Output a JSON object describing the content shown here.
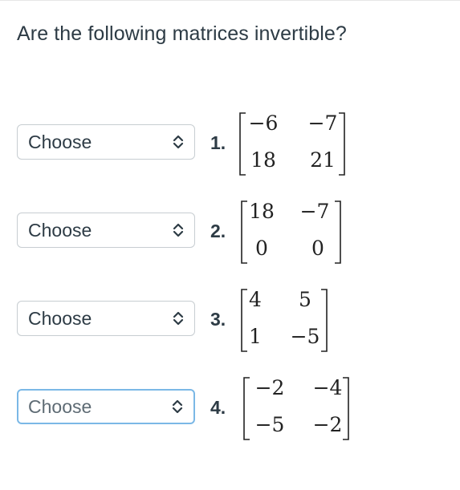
{
  "question": "Are the following matrices invertible?",
  "items": [
    {
      "number": "1.",
      "select": {
        "value": "Choose",
        "focused": false
      },
      "matrix": [
        [
          "−6",
          "−7"
        ],
        [
          "18",
          "21"
        ]
      ]
    },
    {
      "number": "2.",
      "select": {
        "value": "Choose",
        "focused": false
      },
      "matrix": [
        [
          "18",
          "−7"
        ],
        [
          "0",
          "0"
        ]
      ]
    },
    {
      "number": "3.",
      "select": {
        "value": "Choose",
        "focused": false
      },
      "matrix": [
        [
          "4",
          "5"
        ],
        [
          "1",
          "−5"
        ]
      ]
    },
    {
      "number": "4.",
      "select": {
        "value": "Choose",
        "focused": true
      },
      "matrix": [
        [
          "−2",
          "−4"
        ],
        [
          "−5",
          "−2"
        ]
      ]
    }
  ],
  "icons": {
    "select_arrows": "chevron-up-down-icon"
  }
}
